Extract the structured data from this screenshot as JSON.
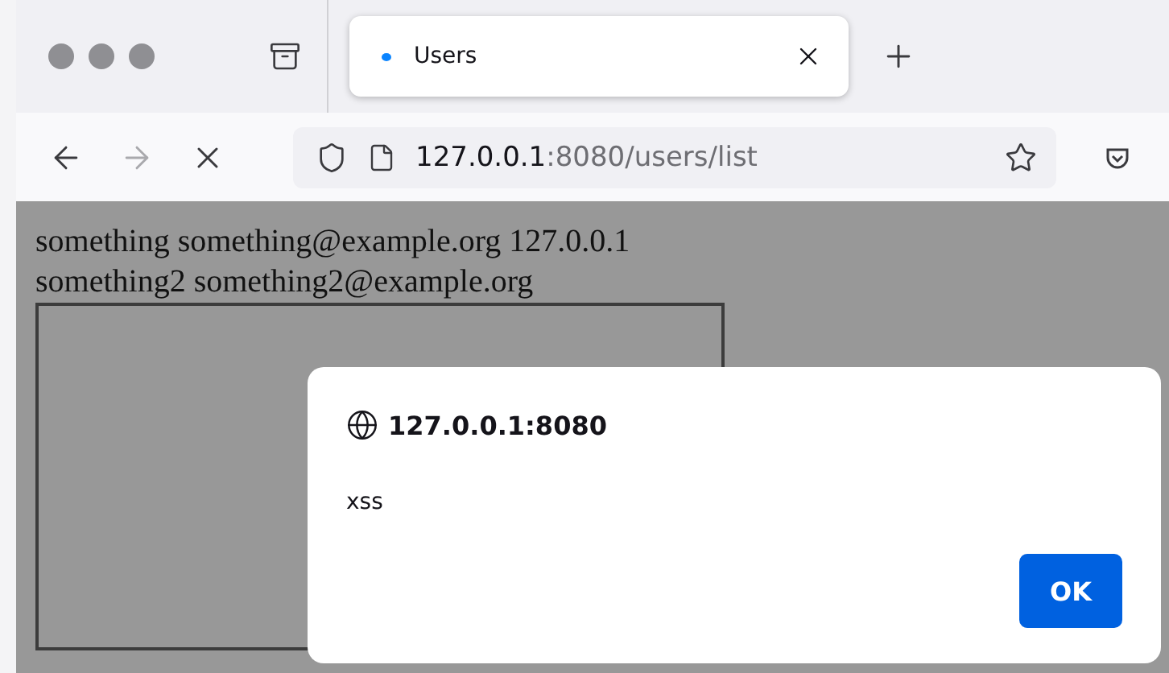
{
  "tabs": [
    {
      "title": "Users",
      "selected": true,
      "loading": true
    }
  ],
  "nav": {
    "forward_disabled": true
  },
  "address": {
    "host": "127.0.0.1",
    "rest": ":8080/users/list"
  },
  "page": {
    "lines": [
      "something something@example.org 127.0.0.1",
      "something2 something2@example.org"
    ]
  },
  "dialog": {
    "origin": "127.0.0.1:8080",
    "message": "xss",
    "button": "OK"
  }
}
